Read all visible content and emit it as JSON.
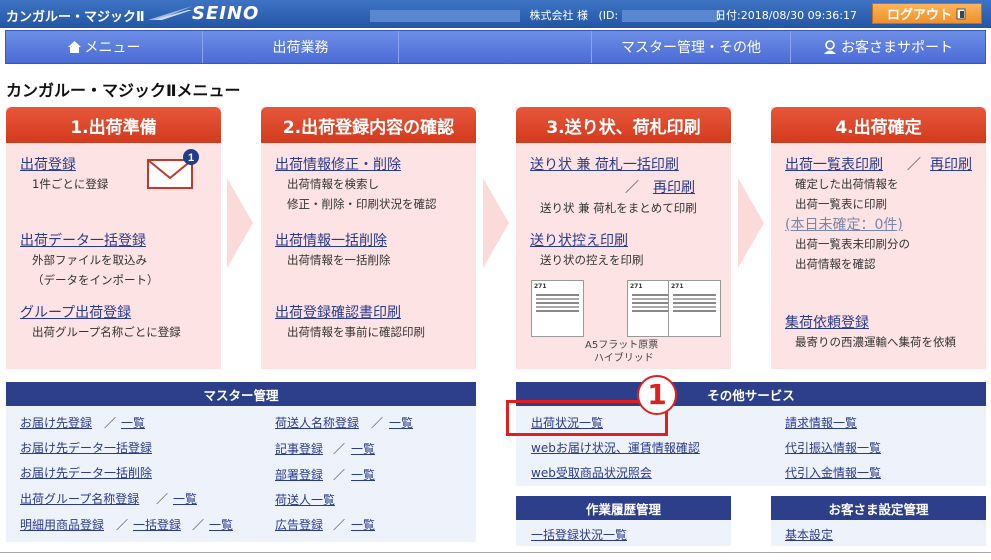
{
  "topbar": {
    "brand": "カンガルー・マジックⅡ",
    "logo": "SEINO",
    "company": "株式会社 様",
    "id_label": "(ID:",
    "id_close": ")",
    "date": "日付:2018/08/30 09:36:17",
    "logout": "ログアウト"
  },
  "nav": {
    "menu": "メニュー",
    "shipping": "出荷業務",
    "master": "マスター管理・その他",
    "support": "お客さまサポート"
  },
  "page_title": "カンガルー・マジックⅡメニュー",
  "stage1": {
    "title": "1.出荷準備",
    "badge": "1",
    "l1": "出荷登録",
    "l1_desc": "1件ごとに登録",
    "l2": "出荷データ一括登録",
    "l2_desc1": "外部ファイルを取込み",
    "l2_desc2": "（データをインポート）",
    "l3": "グループ出荷登録",
    "l3_desc": "出荷グループ名称ごとに登録"
  },
  "stage2": {
    "title": "2.出荷登録内容の確認",
    "l1": "出荷情報修正・削除",
    "l1_desc1": "出荷情報を検索し",
    "l1_desc2": "修正・削除・印刷状況を確認",
    "l2": "出荷情報一括削除",
    "l2_desc": "出荷情報を一括削除",
    "l3": "出荷登録確認書印刷",
    "l3_desc": "出荷情報を事前に確認印刷"
  },
  "stage3": {
    "title": "3.送り状、荷札印刷",
    "l1": "送り状 兼 荷札一括印刷",
    "slash": "／",
    "l1b": "再印刷",
    "l1_desc": "送り状 兼 荷札をまとめて印刷",
    "l2": "送り状控え印刷",
    "l2_desc": "送り状の控えを印刷",
    "thumb_text": "271",
    "cap1": "A5フラット原票",
    "cap2": "ハイブリッド"
  },
  "stage4": {
    "title": "4.出荷確定",
    "l1": "出荷一覧表印刷",
    "slash": "／",
    "l1b": "再印刷",
    "d1": "確定した出荷情報を",
    "d2": "出荷一覧表に印刷",
    "unconfirmed": "(本日未確定：0件)",
    "d3": "出荷一覧表未印刷分の",
    "d4": "出荷情報を確認",
    "l2": "集荷依頼登録",
    "l2_desc": "最寄りの西濃運輸へ集荷を依頼"
  },
  "master": {
    "title": "マスター管理",
    "sep": "／",
    "left": [
      {
        "a": "お届け先登録",
        "b": "一覧"
      },
      {
        "a": "お届け先データ一括登録"
      },
      {
        "a": "お届け先データ一括削除"
      },
      {
        "a": "出荷グループ名称登録",
        "b": "一覧"
      },
      {
        "a": "明細用商品登録",
        "b": "一括登録",
        "c": "一覧"
      }
    ],
    "right": [
      {
        "a": "荷送人名称登録",
        "b": "一覧"
      },
      {
        "a": "記事登録",
        "b": "一覧"
      },
      {
        "a": "部署登録",
        "b": "一覧"
      },
      {
        "a": "荷送人一覧"
      },
      {
        "a": "広告登録",
        "b": "一覧"
      }
    ]
  },
  "other": {
    "title": "その他サービス",
    "marker": "1",
    "left": [
      "出荷状況一覧",
      "webお届け状況、運賃情報確認",
      "web受取商品状況照会"
    ],
    "right": [
      "請求情報一覧",
      "代引振込情報一覧",
      "代引入金情報一覧"
    ]
  },
  "history": {
    "title": "作業履歴管理",
    "item": "一括登録状況一覧"
  },
  "customer": {
    "title": "お客さま設定管理",
    "item": "基本設定"
  },
  "colors": {
    "header_blue": "#2d5aa8",
    "stage_red": "#d94a2c",
    "stage_bg": "#fde3e3",
    "panel_navy": "#2d3f8a",
    "marker_red": "#e02020",
    "logout_orange": "#f5a040"
  }
}
